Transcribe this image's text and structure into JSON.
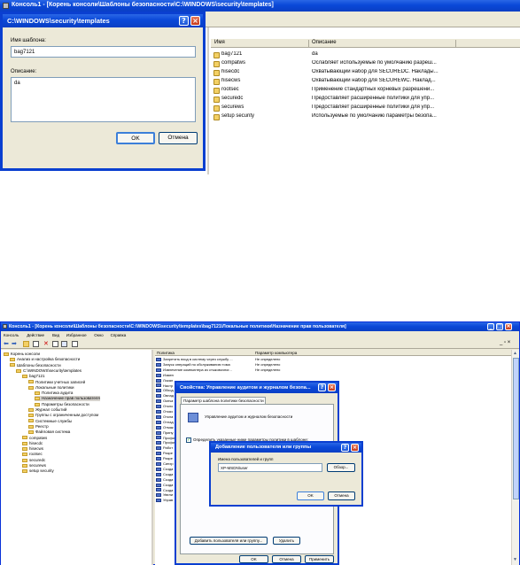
{
  "top": {
    "window_title": "Консоль1 - [Корень консоли\\Шаблоны безопасности\\C:\\WINDOWS\\security\\templates]",
    "list_header": {
      "name": "Имя",
      "description": "Описание"
    },
    "templates": [
      {
        "name": "bag7121",
        "description": "da"
      },
      {
        "name": "compatws",
        "description": "Ослабляет используемые по умолчанию разреш..."
      },
      {
        "name": "hisecdc",
        "description": "Охватывающий набор для SECUREDC. Наклады..."
      },
      {
        "name": "hisecws",
        "description": "Охватывающий набор для SECUREWC. Наклад..."
      },
      {
        "name": "rootsec",
        "description": "Применение стандартных корневых разрешени..."
      },
      {
        "name": "securedc",
        "description": "Предоставляет расширенные политики для упр..."
      },
      {
        "name": "securews",
        "description": "Предоставляет расширенные политики для упр..."
      },
      {
        "name": "setup security",
        "description": "Используемые по умолчанию параметры безопа..."
      }
    ],
    "dialog": {
      "title": "C:\\WINDOWS\\security\\templates",
      "name_label": "Имя шаблона:",
      "name_value": "bag7121",
      "desc_label": "Описание:",
      "desc_value": "da",
      "ok": "OK",
      "cancel": "Отмена"
    }
  },
  "bottom": {
    "window_title": "Консоль1 - [Корень консоли\\Шаблоны безопасности\\C:\\WINDOWS\\security\\templates\\bag7121\\Локальные политики\\Назначение прав пользователя]",
    "menu": [
      "Консоль",
      "Действие",
      "Вид",
      "Избранное",
      "Окно",
      "Справка"
    ],
    "tree": [
      {
        "label": "Корень консоли",
        "level": 0
      },
      {
        "label": "Анализ и настройка безопасности",
        "level": 1
      },
      {
        "label": "Шаблоны безопасности",
        "level": 1
      },
      {
        "label": "C:\\WINDOWS\\security\\templates",
        "level": 2
      },
      {
        "label": "bag7121",
        "level": 3
      },
      {
        "label": "Политики учетных записей",
        "level": 4
      },
      {
        "label": "Локальные политики",
        "level": 4
      },
      {
        "label": "Политика аудита",
        "level": 5
      },
      {
        "label": "Назначение прав пользователя",
        "level": 5
      },
      {
        "label": "Параметры безопасности",
        "level": 5
      },
      {
        "label": "Журнал событий",
        "level": 4
      },
      {
        "label": "Группы с ограниченным доступом",
        "level": 4
      },
      {
        "label": "Системные службы",
        "level": 4
      },
      {
        "label": "Реестр",
        "level": 4
      },
      {
        "label": "Файловая система",
        "level": 4
      },
      {
        "label": "compatws",
        "level": 3
      },
      {
        "label": "hisecdc",
        "level": 3
      },
      {
        "label": "hisecws",
        "level": 3
      },
      {
        "label": "rootsec",
        "level": 3
      },
      {
        "label": "securedc",
        "level": 3
      },
      {
        "label": "securews",
        "level": 3
      },
      {
        "label": "setup security",
        "level": 3
      }
    ],
    "list_header": {
      "policy": "Политика",
      "setting": "Параметр компьютера"
    },
    "policies": [
      {
        "name": "Запретить вход в систему через службу ...",
        "value": "Не определено"
      },
      {
        "name": "Запуск операций по обслуживанию тома",
        "value": "Не определено"
      },
      {
        "name": "Извлечение компьютера из стыковочног...",
        "value": "Не определено"
      },
      {
        "name": "Измен",
        "value": ""
      },
      {
        "name": "Локал",
        "value": ""
      },
      {
        "name": "Настр",
        "value": ""
      },
      {
        "name": "Обход",
        "value": ""
      },
      {
        "name": "Овлад",
        "value": ""
      },
      {
        "name": "Окнча",
        "value": ""
      },
      {
        "name": "Откло",
        "value": ""
      },
      {
        "name": "Отказ",
        "value": ""
      },
      {
        "name": "Откла",
        "value": ""
      },
      {
        "name": "Отлад",
        "value": ""
      },
      {
        "name": "Отмак",
        "value": ""
      },
      {
        "name": "Прину",
        "value": ""
      },
      {
        "name": "Профи",
        "value": ""
      },
      {
        "name": "Профи",
        "value": ""
      },
      {
        "name": "Работ",
        "value": ""
      },
      {
        "name": "Разре",
        "value": ""
      },
      {
        "name": "Разре",
        "value": ""
      },
      {
        "name": "Синхр",
        "value": ""
      },
      {
        "name": "Созда",
        "value": ""
      },
      {
        "name": "Созда",
        "value": ""
      },
      {
        "name": "Созда",
        "value": ""
      },
      {
        "name": "Созда",
        "value": ""
      },
      {
        "name": "Созда",
        "value": ""
      },
      {
        "name": "Увели",
        "value": ""
      },
      {
        "name": "Управ",
        "value": ""
      }
    ],
    "props_dialog": {
      "title": "Свойства: Управление аудитом и журналом безопа...",
      "tab": "Параметр шаблона политики безопасности",
      "policy_name": "Управление аудитом и журналом безопасности",
      "checkbox_label": "Определить указанные ниже параметры политики в шаблоне:",
      "add_button": "Добавить пользователя или группу...",
      "remove_button": "Удалить",
      "ok": "OK",
      "cancel": "Отмена",
      "apply": "Применить"
    },
    "add_dialog": {
      "title": "Добавление пользователя или группы",
      "label": "Имена пользователей и групп",
      "value": "XP-MSDN\\user",
      "browse": "Обзор...",
      "ok": "OK",
      "cancel": "Отмена"
    }
  }
}
